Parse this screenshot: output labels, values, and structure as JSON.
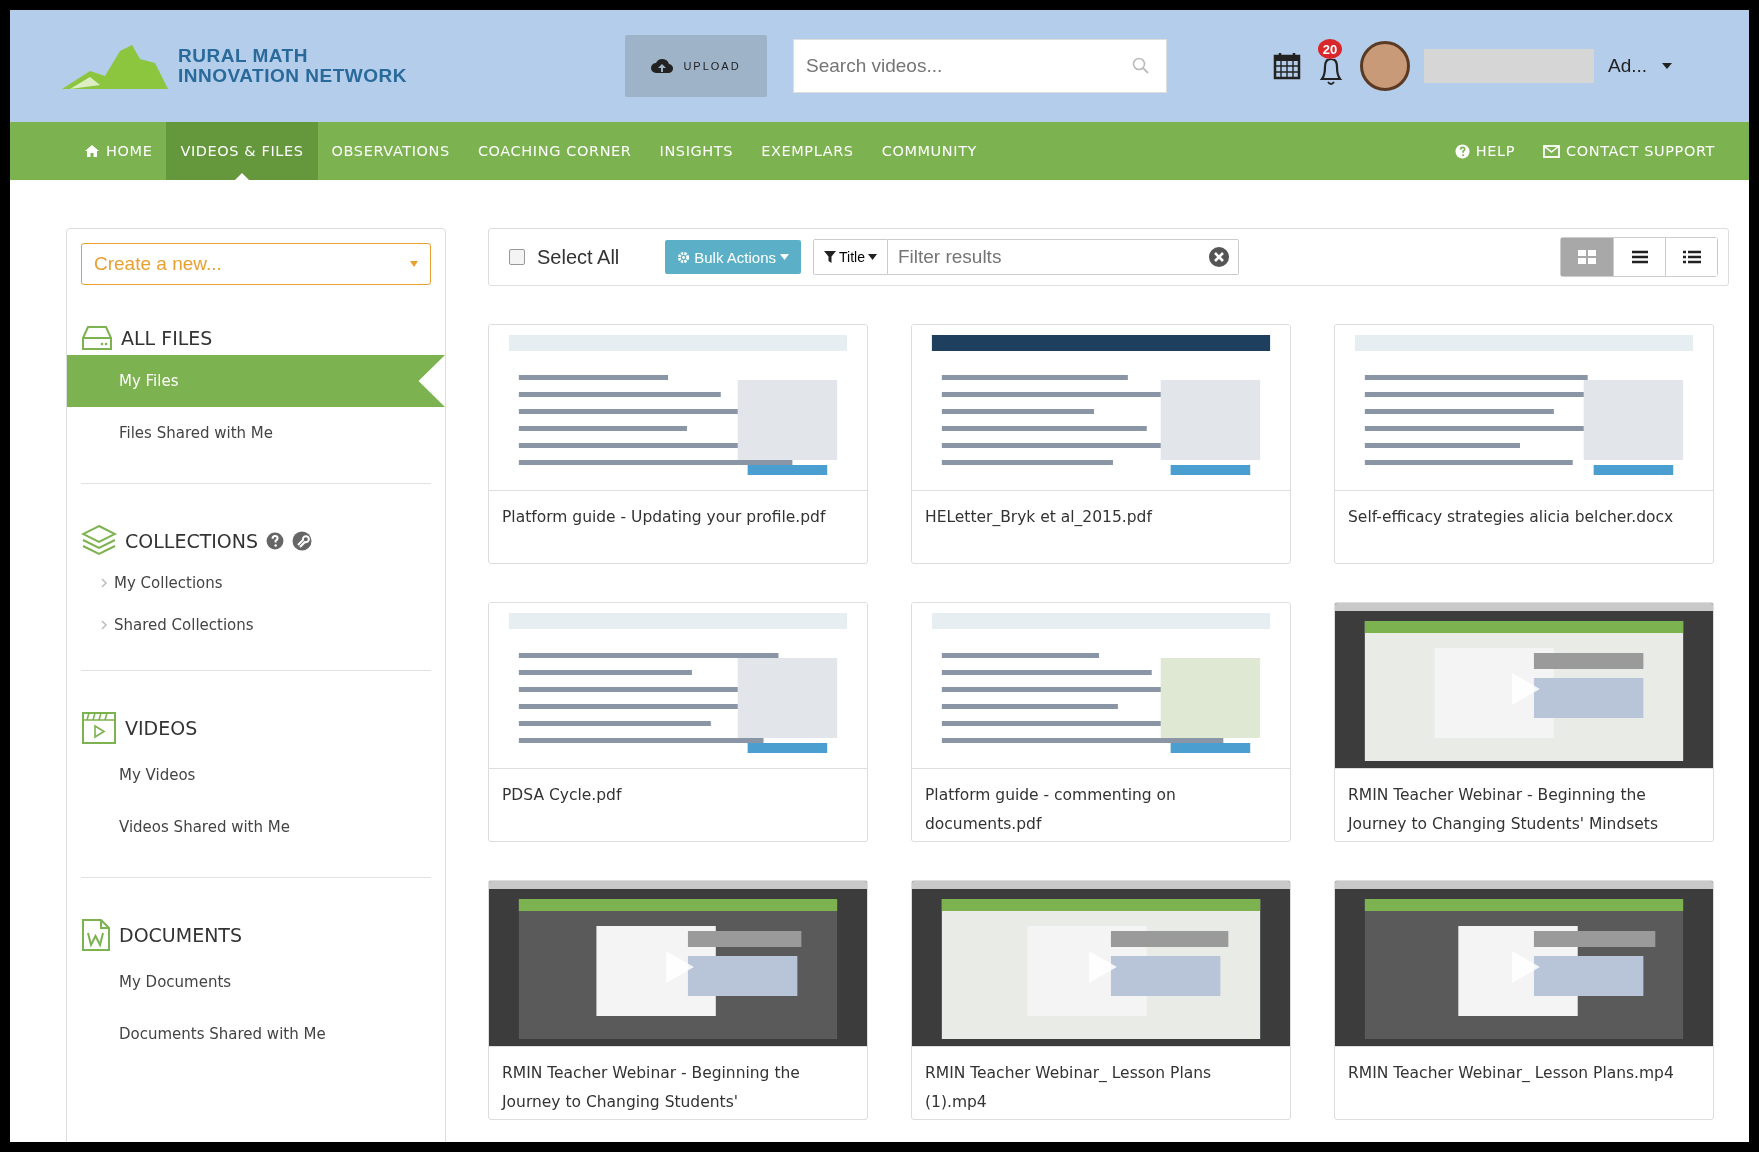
{
  "header": {
    "logo_lines": [
      "RURAL MATH",
      "INNOVATION NETWORK"
    ],
    "upload": "UPLOAD",
    "search": {
      "placeholder": "Search videos..."
    },
    "notification_count": "20",
    "user_name": "Ad..."
  },
  "nav": {
    "items": [
      {
        "label": "HOME",
        "kind": "home",
        "selected": false
      },
      {
        "label": "VIDEOS & FILES",
        "kind": "plain",
        "selected": true
      },
      {
        "label": "OBSERVATIONS",
        "kind": "plain",
        "selected": false
      },
      {
        "label": "COACHING CORNER",
        "kind": "plain",
        "selected": false
      },
      {
        "label": "INSIGHTS",
        "kind": "plain",
        "selected": false
      },
      {
        "label": "EXEMPLARS",
        "kind": "plain",
        "selected": false
      },
      {
        "label": "COMMUNITY",
        "kind": "plain",
        "selected": false
      }
    ],
    "right_items": [
      {
        "label": "HELP",
        "kind": "help"
      },
      {
        "label": "CONTACT SUPPORT",
        "kind": "mail"
      }
    ]
  },
  "sidebar": {
    "create_select": "Create a new...",
    "sections": [
      {
        "title": "ALL FILES",
        "kind": "files",
        "items": [
          {
            "label": "My Files",
            "selected": true
          },
          {
            "label": "Files Shared with Me",
            "selected": false
          }
        ]
      },
      {
        "title": "COLLECTIONS",
        "kind": "collections",
        "items": [
          {
            "label": "My Collections",
            "selected": false
          },
          {
            "label": "Shared Collections",
            "selected": false
          }
        ]
      },
      {
        "title": "VIDEOS",
        "kind": "videos",
        "items": [
          {
            "label": "My Videos",
            "selected": false
          },
          {
            "label": "Videos Shared with Me",
            "selected": false
          }
        ]
      },
      {
        "title": "DOCUMENTS",
        "kind": "documents",
        "items": [
          {
            "label": "My Documents",
            "selected": false
          },
          {
            "label": "Documents Shared with Me",
            "selected": false
          }
        ]
      }
    ]
  },
  "toolbar": {
    "select_all": {
      "label": "Select All",
      "checked": false
    },
    "bulk_actions": "Bulk Actions",
    "filter_field": "Title",
    "filter": {
      "placeholder": "Filter results"
    },
    "views": [
      {
        "kind": "grid",
        "selected": true
      },
      {
        "kind": "list",
        "selected": false
      },
      {
        "kind": "details",
        "selected": false
      }
    ]
  },
  "files": [
    {
      "name": "Platform guide - Updating your profile.pdf"
    },
    {
      "name": "HELetter_Bryk et al_2015.pdf"
    },
    {
      "name": "Self-efficacy strategies alicia belcher.docx"
    },
    {
      "name": "PDSA Cycle.pdf"
    },
    {
      "name": "Platform guide - commenting on documents.pdf"
    },
    {
      "name": "RMIN Teacher Webinar - Beginning the Journey to Changing Students' Mindsets"
    },
    {
      "name": "RMIN Teacher Webinar - Beginning the Journey to Changing Students'"
    },
    {
      "name": "RMIN Teacher Webinar_ Lesson Plans (1).mp4"
    },
    {
      "name": "RMIN Teacher Webinar_ Lesson Plans.mp4"
    }
  ]
}
